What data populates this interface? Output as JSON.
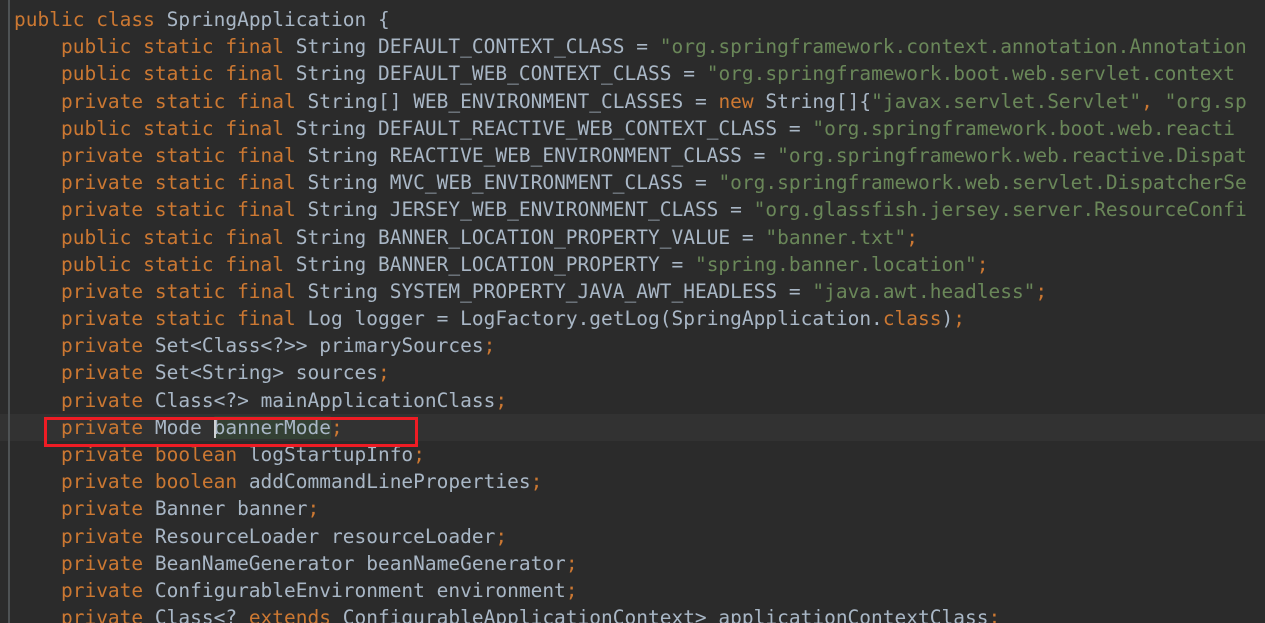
{
  "editor": {
    "language": "java",
    "theme": "darcula",
    "background_color": "#2b2b2b",
    "caret_line_color": "#323232",
    "keyword_color": "#cc7832",
    "string_color": "#6a8759",
    "identifier_color": "#a9b7c6",
    "identifier_highlight_color": "#344134",
    "annotation_box_color": "#ee1c24",
    "gutter_rule_color": "#4e5254"
  },
  "annotation": {
    "name": "red-highlight-box",
    "target_text": "private Mode bannerMode;"
  },
  "caret": {
    "line_index": 15,
    "before_token": "bannerMode",
    "highlighted_identifier": "bannerMode"
  },
  "code": {
    "lines": [
      {
        "id": "line-1",
        "caret": false,
        "tokens": [
          {
            "t": "kw",
            "v": "public "
          },
          {
            "t": "kw",
            "v": "class "
          },
          {
            "t": "typ",
            "v": "SpringApplication "
          },
          {
            "t": "pun",
            "v": "{"
          }
        ]
      },
      {
        "id": "line-2",
        "caret": false,
        "tokens": [
          {
            "t": "pun",
            "v": "    "
          },
          {
            "t": "kw",
            "v": "public static final "
          },
          {
            "t": "typ",
            "v": "String "
          },
          {
            "t": "id",
            "v": "DEFAULT_CONTEXT_CLASS "
          },
          {
            "t": "pun",
            "v": "= "
          },
          {
            "t": "str",
            "v": "\"org.springframework.context.annotation.Annotation"
          }
        ]
      },
      {
        "id": "line-3",
        "caret": false,
        "tokens": [
          {
            "t": "pun",
            "v": "    "
          },
          {
            "t": "kw",
            "v": "public static final "
          },
          {
            "t": "typ",
            "v": "String "
          },
          {
            "t": "id",
            "v": "DEFAULT_WEB_CONTEXT_CLASS "
          },
          {
            "t": "pun",
            "v": "= "
          },
          {
            "t": "str",
            "v": "\"org.springframework.boot.web.servlet.context"
          }
        ]
      },
      {
        "id": "line-4",
        "caret": false,
        "tokens": [
          {
            "t": "pun",
            "v": "    "
          },
          {
            "t": "kw",
            "v": "private static final "
          },
          {
            "t": "typ",
            "v": "String[] "
          },
          {
            "t": "id",
            "v": "WEB_ENVIRONMENT_CLASSES "
          },
          {
            "t": "pun",
            "v": "= "
          },
          {
            "t": "kw",
            "v": "new "
          },
          {
            "t": "typ",
            "v": "String"
          },
          {
            "t": "pun",
            "v": "[]{"
          },
          {
            "t": "str",
            "v": "\"javax.servlet.Servlet\""
          },
          {
            "t": "semi",
            "v": ", "
          },
          {
            "t": "str",
            "v": "\"org.sp"
          }
        ]
      },
      {
        "id": "line-5",
        "caret": false,
        "tokens": [
          {
            "t": "pun",
            "v": "    "
          },
          {
            "t": "kw",
            "v": "public static final "
          },
          {
            "t": "typ",
            "v": "String "
          },
          {
            "t": "id",
            "v": "DEFAULT_REACTIVE_WEB_CONTEXT_CLASS "
          },
          {
            "t": "pun",
            "v": "= "
          },
          {
            "t": "str",
            "v": "\"org.springframework.boot.web.reacti"
          }
        ]
      },
      {
        "id": "line-6",
        "caret": false,
        "tokens": [
          {
            "t": "pun",
            "v": "    "
          },
          {
            "t": "kw",
            "v": "private static final "
          },
          {
            "t": "typ",
            "v": "String "
          },
          {
            "t": "id",
            "v": "REACTIVE_WEB_ENVIRONMENT_CLASS "
          },
          {
            "t": "pun",
            "v": "= "
          },
          {
            "t": "str",
            "v": "\"org.springframework.web.reactive.Dispat"
          }
        ]
      },
      {
        "id": "line-7",
        "caret": false,
        "tokens": [
          {
            "t": "pun",
            "v": "    "
          },
          {
            "t": "kw",
            "v": "private static final "
          },
          {
            "t": "typ",
            "v": "String "
          },
          {
            "t": "id",
            "v": "MVC_WEB_ENVIRONMENT_CLASS "
          },
          {
            "t": "pun",
            "v": "= "
          },
          {
            "t": "str",
            "v": "\"org.springframework.web.servlet.DispatcherSe"
          }
        ]
      },
      {
        "id": "line-8",
        "caret": false,
        "tokens": [
          {
            "t": "pun",
            "v": "    "
          },
          {
            "t": "kw",
            "v": "private static final "
          },
          {
            "t": "typ",
            "v": "String "
          },
          {
            "t": "id",
            "v": "JERSEY_WEB_ENVIRONMENT_CLASS "
          },
          {
            "t": "pun",
            "v": "= "
          },
          {
            "t": "str",
            "v": "\"org.glassfish.jersey.server.ResourceConfi"
          }
        ]
      },
      {
        "id": "line-9",
        "caret": false,
        "tokens": [
          {
            "t": "pun",
            "v": "    "
          },
          {
            "t": "kw",
            "v": "public static final "
          },
          {
            "t": "typ",
            "v": "String "
          },
          {
            "t": "id",
            "v": "BANNER_LOCATION_PROPERTY_VALUE "
          },
          {
            "t": "pun",
            "v": "= "
          },
          {
            "t": "str",
            "v": "\"banner.txt\""
          },
          {
            "t": "semi",
            "v": ";"
          }
        ]
      },
      {
        "id": "line-10",
        "caret": false,
        "tokens": [
          {
            "t": "pun",
            "v": "    "
          },
          {
            "t": "kw",
            "v": "public static final "
          },
          {
            "t": "typ",
            "v": "String "
          },
          {
            "t": "id",
            "v": "BANNER_LOCATION_PROPERTY "
          },
          {
            "t": "pun",
            "v": "= "
          },
          {
            "t": "str",
            "v": "\"spring.banner.location\""
          },
          {
            "t": "semi",
            "v": ";"
          }
        ]
      },
      {
        "id": "line-11",
        "caret": false,
        "tokens": [
          {
            "t": "pun",
            "v": "    "
          },
          {
            "t": "kw",
            "v": "private static final "
          },
          {
            "t": "typ",
            "v": "String "
          },
          {
            "t": "id",
            "v": "SYSTEM_PROPERTY_JAVA_AWT_HEADLESS "
          },
          {
            "t": "pun",
            "v": "= "
          },
          {
            "t": "str",
            "v": "\"java.awt.headless\""
          },
          {
            "t": "semi",
            "v": ";"
          }
        ]
      },
      {
        "id": "line-12",
        "caret": false,
        "tokens": [
          {
            "t": "pun",
            "v": "    "
          },
          {
            "t": "kw",
            "v": "private static final "
          },
          {
            "t": "typ",
            "v": "Log "
          },
          {
            "t": "id",
            "v": "logger "
          },
          {
            "t": "pun",
            "v": "= "
          },
          {
            "t": "typ",
            "v": "LogFactory"
          },
          {
            "t": "pun",
            "v": ".getLog(SpringApplication."
          },
          {
            "t": "kw",
            "v": "class"
          },
          {
            "t": "pun",
            "v": ")"
          },
          {
            "t": "semi",
            "v": ";"
          }
        ]
      },
      {
        "id": "line-13",
        "caret": false,
        "tokens": [
          {
            "t": "pun",
            "v": "    "
          },
          {
            "t": "kw",
            "v": "private "
          },
          {
            "t": "typ",
            "v": "Set<Class<?>> "
          },
          {
            "t": "id",
            "v": "primarySources"
          },
          {
            "t": "semi",
            "v": ";"
          }
        ]
      },
      {
        "id": "line-14",
        "caret": false,
        "tokens": [
          {
            "t": "pun",
            "v": "    "
          },
          {
            "t": "kw",
            "v": "private "
          },
          {
            "t": "typ",
            "v": "Set<String> "
          },
          {
            "t": "id",
            "v": "sources"
          },
          {
            "t": "semi",
            "v": ";"
          }
        ]
      },
      {
        "id": "line-15",
        "caret": false,
        "tokens": [
          {
            "t": "pun",
            "v": "    "
          },
          {
            "t": "kw",
            "v": "private "
          },
          {
            "t": "typ",
            "v": "Class<?> "
          },
          {
            "t": "id",
            "v": "mainApplicationClass"
          },
          {
            "t": "semi",
            "v": ";"
          }
        ]
      },
      {
        "id": "line-16",
        "caret": true,
        "tokens": [
          {
            "t": "pun",
            "v": "    "
          },
          {
            "t": "kw",
            "v": "private "
          },
          {
            "t": "typ",
            "v": "Mode "
          },
          {
            "t": "caret",
            "v": ""
          },
          {
            "t": "id hl",
            "v": "bannerMode"
          },
          {
            "t": "semi",
            "v": ";"
          }
        ]
      },
      {
        "id": "line-17",
        "caret": false,
        "tokens": [
          {
            "t": "pun",
            "v": "    "
          },
          {
            "t": "kw",
            "v": "private boolean "
          },
          {
            "t": "id",
            "v": "logStartupInfo"
          },
          {
            "t": "semi",
            "v": ";"
          }
        ]
      },
      {
        "id": "line-18",
        "caret": false,
        "tokens": [
          {
            "t": "pun",
            "v": "    "
          },
          {
            "t": "kw",
            "v": "private boolean "
          },
          {
            "t": "id",
            "v": "addCommandLineProperties"
          },
          {
            "t": "semi",
            "v": ";"
          }
        ]
      },
      {
        "id": "line-19",
        "caret": false,
        "tokens": [
          {
            "t": "pun",
            "v": "    "
          },
          {
            "t": "kw",
            "v": "private "
          },
          {
            "t": "typ",
            "v": "Banner "
          },
          {
            "t": "id",
            "v": "banner"
          },
          {
            "t": "semi",
            "v": ";"
          }
        ]
      },
      {
        "id": "line-20",
        "caret": false,
        "tokens": [
          {
            "t": "pun",
            "v": "    "
          },
          {
            "t": "kw",
            "v": "private "
          },
          {
            "t": "typ",
            "v": "ResourceLoader "
          },
          {
            "t": "id",
            "v": "resourceLoader"
          },
          {
            "t": "semi",
            "v": ";"
          }
        ]
      },
      {
        "id": "line-21",
        "caret": false,
        "tokens": [
          {
            "t": "pun",
            "v": "    "
          },
          {
            "t": "kw",
            "v": "private "
          },
          {
            "t": "typ",
            "v": "BeanNameGenerator "
          },
          {
            "t": "id",
            "v": "beanNameGenerator"
          },
          {
            "t": "semi",
            "v": ";"
          }
        ]
      },
      {
        "id": "line-22",
        "caret": false,
        "tokens": [
          {
            "t": "pun",
            "v": "    "
          },
          {
            "t": "kw",
            "v": "private "
          },
          {
            "t": "typ",
            "v": "ConfigurableEnvironment "
          },
          {
            "t": "id",
            "v": "environment"
          },
          {
            "t": "semi",
            "v": ";"
          }
        ]
      },
      {
        "id": "line-23",
        "caret": false,
        "tokens": [
          {
            "t": "pun",
            "v": "    "
          },
          {
            "t": "kw",
            "v": "private "
          },
          {
            "t": "typ",
            "v": "Class<? "
          },
          {
            "t": "kw",
            "v": "extends "
          },
          {
            "t": "typ",
            "v": "ConfigurableApplicationContext> "
          },
          {
            "t": "id",
            "v": "applicationContextClass"
          },
          {
            "t": "semi",
            "v": ";"
          }
        ]
      }
    ]
  }
}
